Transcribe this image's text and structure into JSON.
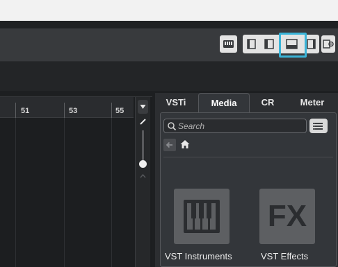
{
  "ruler": {
    "labels": [
      "51",
      "53",
      "55"
    ]
  },
  "zone_tabs": [
    {
      "label": "VSTi",
      "active": false
    },
    {
      "label": "Media",
      "active": true
    },
    {
      "label": "CR",
      "active": false
    },
    {
      "label": "Meter",
      "active": false
    }
  ],
  "media_panel": {
    "search": {
      "placeholder": "Search",
      "value": ""
    },
    "tiles": [
      {
        "label": "VST Instruments",
        "icon": "piano-keys-icon"
      },
      {
        "label": "VST Effects",
        "icon": "fx-icon",
        "glyph": "FX"
      }
    ]
  },
  "toolbar": {
    "icons": [
      "midi-keyboard-icon",
      "left-zone-icon",
      "left-zone-alt-icon",
      "lower-zone-icon",
      "right-zone-icon",
      "setup-window-layout-icon"
    ],
    "highlight_color": "#3ab4d8"
  }
}
